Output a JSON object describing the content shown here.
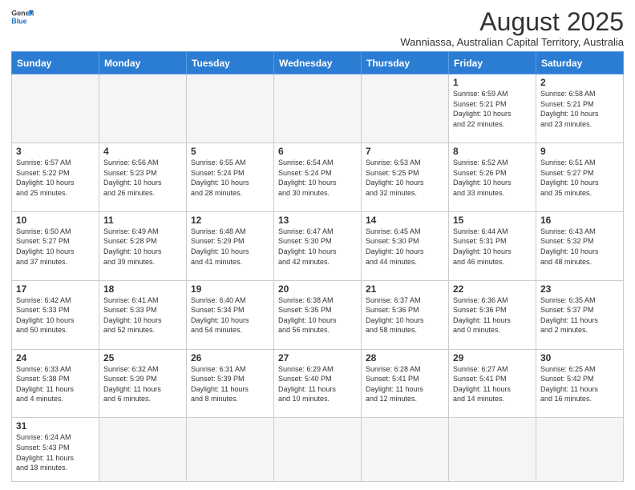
{
  "logo": {
    "text_general": "General",
    "text_blue": "Blue"
  },
  "header": {
    "month_title": "August 2025",
    "subtitle": "Wanniassa, Australian Capital Territory, Australia"
  },
  "days_of_week": [
    "Sunday",
    "Monday",
    "Tuesday",
    "Wednesday",
    "Thursday",
    "Friday",
    "Saturday"
  ],
  "weeks": [
    [
      {
        "day": "",
        "info": ""
      },
      {
        "day": "",
        "info": ""
      },
      {
        "day": "",
        "info": ""
      },
      {
        "day": "",
        "info": ""
      },
      {
        "day": "",
        "info": ""
      },
      {
        "day": "1",
        "info": "Sunrise: 6:59 AM\nSunset: 5:21 PM\nDaylight: 10 hours\nand 22 minutes."
      },
      {
        "day": "2",
        "info": "Sunrise: 6:58 AM\nSunset: 5:21 PM\nDaylight: 10 hours\nand 23 minutes."
      }
    ],
    [
      {
        "day": "3",
        "info": "Sunrise: 6:57 AM\nSunset: 5:22 PM\nDaylight: 10 hours\nand 25 minutes."
      },
      {
        "day": "4",
        "info": "Sunrise: 6:56 AM\nSunset: 5:23 PM\nDaylight: 10 hours\nand 26 minutes."
      },
      {
        "day": "5",
        "info": "Sunrise: 6:55 AM\nSunset: 5:24 PM\nDaylight: 10 hours\nand 28 minutes."
      },
      {
        "day": "6",
        "info": "Sunrise: 6:54 AM\nSunset: 5:24 PM\nDaylight: 10 hours\nand 30 minutes."
      },
      {
        "day": "7",
        "info": "Sunrise: 6:53 AM\nSunset: 5:25 PM\nDaylight: 10 hours\nand 32 minutes."
      },
      {
        "day": "8",
        "info": "Sunrise: 6:52 AM\nSunset: 5:26 PM\nDaylight: 10 hours\nand 33 minutes."
      },
      {
        "day": "9",
        "info": "Sunrise: 6:51 AM\nSunset: 5:27 PM\nDaylight: 10 hours\nand 35 minutes."
      }
    ],
    [
      {
        "day": "10",
        "info": "Sunrise: 6:50 AM\nSunset: 5:27 PM\nDaylight: 10 hours\nand 37 minutes."
      },
      {
        "day": "11",
        "info": "Sunrise: 6:49 AM\nSunset: 5:28 PM\nDaylight: 10 hours\nand 39 minutes."
      },
      {
        "day": "12",
        "info": "Sunrise: 6:48 AM\nSunset: 5:29 PM\nDaylight: 10 hours\nand 41 minutes."
      },
      {
        "day": "13",
        "info": "Sunrise: 6:47 AM\nSunset: 5:30 PM\nDaylight: 10 hours\nand 42 minutes."
      },
      {
        "day": "14",
        "info": "Sunrise: 6:45 AM\nSunset: 5:30 PM\nDaylight: 10 hours\nand 44 minutes."
      },
      {
        "day": "15",
        "info": "Sunrise: 6:44 AM\nSunset: 5:31 PM\nDaylight: 10 hours\nand 46 minutes."
      },
      {
        "day": "16",
        "info": "Sunrise: 6:43 AM\nSunset: 5:32 PM\nDaylight: 10 hours\nand 48 minutes."
      }
    ],
    [
      {
        "day": "17",
        "info": "Sunrise: 6:42 AM\nSunset: 5:33 PM\nDaylight: 10 hours\nand 50 minutes."
      },
      {
        "day": "18",
        "info": "Sunrise: 6:41 AM\nSunset: 5:33 PM\nDaylight: 10 hours\nand 52 minutes."
      },
      {
        "day": "19",
        "info": "Sunrise: 6:40 AM\nSunset: 5:34 PM\nDaylight: 10 hours\nand 54 minutes."
      },
      {
        "day": "20",
        "info": "Sunrise: 6:38 AM\nSunset: 5:35 PM\nDaylight: 10 hours\nand 56 minutes."
      },
      {
        "day": "21",
        "info": "Sunrise: 6:37 AM\nSunset: 5:36 PM\nDaylight: 10 hours\nand 58 minutes."
      },
      {
        "day": "22",
        "info": "Sunrise: 6:36 AM\nSunset: 5:36 PM\nDaylight: 11 hours\nand 0 minutes."
      },
      {
        "day": "23",
        "info": "Sunrise: 6:35 AM\nSunset: 5:37 PM\nDaylight: 11 hours\nand 2 minutes."
      }
    ],
    [
      {
        "day": "24",
        "info": "Sunrise: 6:33 AM\nSunset: 5:38 PM\nDaylight: 11 hours\nand 4 minutes."
      },
      {
        "day": "25",
        "info": "Sunrise: 6:32 AM\nSunset: 5:39 PM\nDaylight: 11 hours\nand 6 minutes."
      },
      {
        "day": "26",
        "info": "Sunrise: 6:31 AM\nSunset: 5:39 PM\nDaylight: 11 hours\nand 8 minutes."
      },
      {
        "day": "27",
        "info": "Sunrise: 6:29 AM\nSunset: 5:40 PM\nDaylight: 11 hours\nand 10 minutes."
      },
      {
        "day": "28",
        "info": "Sunrise: 6:28 AM\nSunset: 5:41 PM\nDaylight: 11 hours\nand 12 minutes."
      },
      {
        "day": "29",
        "info": "Sunrise: 6:27 AM\nSunset: 5:41 PM\nDaylight: 11 hours\nand 14 minutes."
      },
      {
        "day": "30",
        "info": "Sunrise: 6:25 AM\nSunset: 5:42 PM\nDaylight: 11 hours\nand 16 minutes."
      }
    ],
    [
      {
        "day": "31",
        "info": "Sunrise: 6:24 AM\nSunset: 5:43 PM\nDaylight: 11 hours\nand 18 minutes."
      },
      {
        "day": "",
        "info": ""
      },
      {
        "day": "",
        "info": ""
      },
      {
        "day": "",
        "info": ""
      },
      {
        "day": "",
        "info": ""
      },
      {
        "day": "",
        "info": ""
      },
      {
        "day": "",
        "info": ""
      }
    ]
  ]
}
